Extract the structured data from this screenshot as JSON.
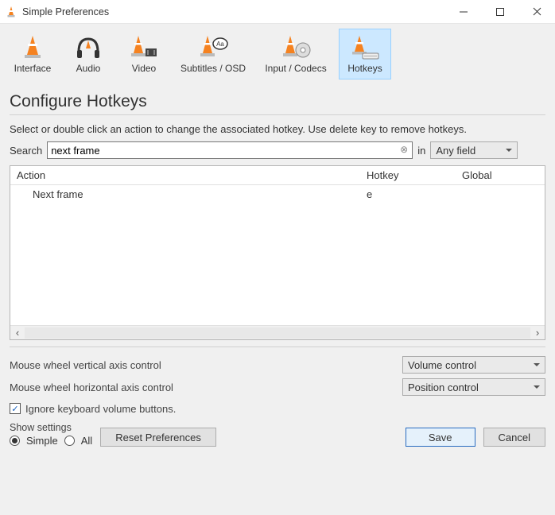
{
  "window": {
    "title": "Simple Preferences"
  },
  "tabs": [
    {
      "label": "Interface"
    },
    {
      "label": "Audio"
    },
    {
      "label": "Video"
    },
    {
      "label": "Subtitles / OSD"
    },
    {
      "label": "Input / Codecs"
    },
    {
      "label": "Hotkeys"
    }
  ],
  "heading": "Configure Hotkeys",
  "instruction": "Select or double click an action to change the associated hotkey. Use delete key to remove hotkeys.",
  "search": {
    "label": "Search",
    "value": "next frame",
    "in_label": "in",
    "field_select": "Any field"
  },
  "table": {
    "cols": {
      "action": "Action",
      "hotkey": "Hotkey",
      "global": "Global"
    },
    "rows": [
      {
        "action": "Next frame",
        "hotkey": "e",
        "global": ""
      }
    ]
  },
  "options": {
    "mouse_vert_label": "Mouse wheel vertical axis control",
    "mouse_vert_value": "Volume control",
    "mouse_horiz_label": "Mouse wheel horizontal axis control",
    "mouse_horiz_value": "Position control",
    "ignore_kb_label": "Ignore keyboard volume buttons.",
    "ignore_kb_checked": true
  },
  "footer": {
    "show_settings_label": "Show settings",
    "radio_simple": "Simple",
    "radio_all": "All",
    "reset": "Reset Preferences",
    "save": "Save",
    "cancel": "Cancel"
  }
}
